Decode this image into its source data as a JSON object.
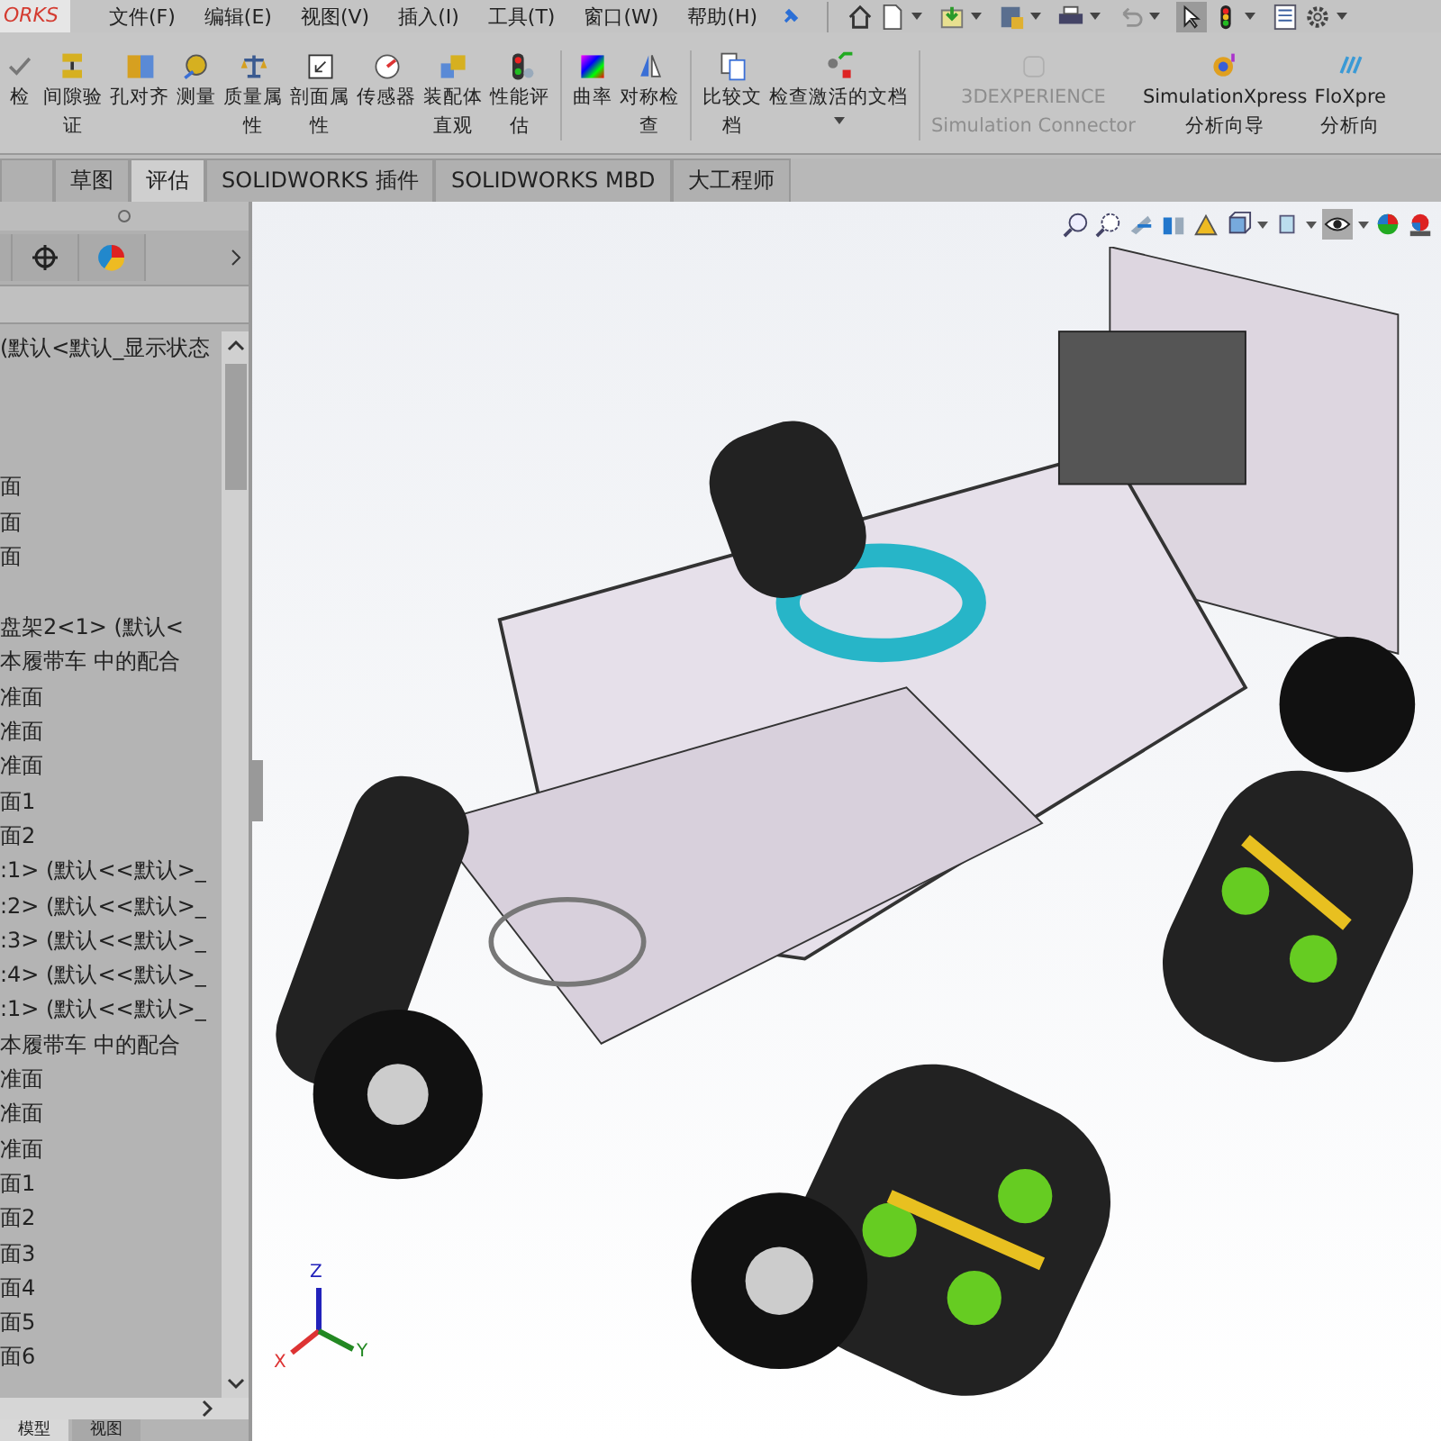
{
  "app_logo": "ORKS",
  "menu": [
    "文件(F)",
    "编辑(E)",
    "视图(V)",
    "插入(I)",
    "工具(T)",
    "窗口(W)",
    "帮助(H)"
  ],
  "quick_access": [
    {
      "kind": "home",
      "disabled": false
    },
    {
      "kind": "new",
      "disabled": false
    },
    {
      "kind": "open",
      "disabled": false
    },
    {
      "kind": "save",
      "disabled": false
    },
    {
      "kind": "print",
      "disabled": false
    },
    {
      "kind": "undo",
      "disabled": true
    },
    {
      "kind": "select",
      "disabled": false
    },
    {
      "kind": "traffic",
      "disabled": false
    },
    {
      "kind": "list",
      "disabled": false
    },
    {
      "kind": "gear",
      "disabled": false
    }
  ],
  "ribbon": [
    [
      {
        "kind": "check",
        "lines": [
          "检"
        ],
        "disabled": false
      },
      {
        "kind": "clearance",
        "lines": [
          "间隙验",
          "证"
        ],
        "disabled": false
      },
      {
        "kind": "hole",
        "lines": [
          "孔对齐"
        ],
        "disabled": false
      },
      {
        "kind": "measure",
        "lines": [
          "测量"
        ],
        "disabled": false
      },
      {
        "kind": "mass",
        "lines": [
          "质量属",
          "性"
        ],
        "disabled": false
      },
      {
        "kind": "section",
        "lines": [
          "剖面属",
          "性"
        ],
        "disabled": false
      },
      {
        "kind": "sensor",
        "lines": [
          "传感器"
        ],
        "disabled": false
      },
      {
        "kind": "assembly",
        "lines": [
          "装配体",
          "直观"
        ],
        "disabled": false
      },
      {
        "kind": "perf",
        "lines": [
          "性能评",
          "估"
        ],
        "disabled": false
      }
    ],
    [
      {
        "kind": "curvature",
        "lines": [
          "曲率"
        ],
        "disabled": false
      },
      {
        "kind": "symmetry",
        "lines": [
          "对称检",
          "查"
        ],
        "disabled": false
      }
    ],
    [
      {
        "kind": "compare",
        "lines": [
          "比较文",
          "档"
        ],
        "disabled": false
      },
      {
        "kind": "checkdoc",
        "lines": [
          "检查激活的文档"
        ],
        "disabled": false
      }
    ],
    [
      {
        "kind": "connector",
        "lines": [
          "3DEXPERIENCE",
          "Simulation Connector"
        ],
        "disabled": true
      },
      {
        "kind": "simxpress",
        "lines": [
          "SimulationXpress",
          "分析向导"
        ],
        "disabled": false
      },
      {
        "kind": "floxpress",
        "lines": [
          "FloXpre",
          "分析向"
        ],
        "disabled": false
      }
    ]
  ],
  "tabs": [
    {
      "label": "草图",
      "selected": false
    },
    {
      "label": "评估",
      "selected": true
    },
    {
      "label": "SOLIDWORKS 插件",
      "selected": false
    },
    {
      "label": "SOLIDWORKS MBD",
      "selected": false
    },
    {
      "label": "大工程师",
      "selected": false
    }
  ],
  "tree": {
    "groups": [
      [
        "(默认<默认_显示状态"
      ],
      [
        "面",
        "面",
        "面"
      ],
      [
        "盘架2<1> (默认<",
        "本履带车 中的配合",
        "准面",
        "准面",
        "准面",
        "面1",
        "面2",
        ":1> (默认<<默认>_",
        ":2> (默认<<默认>_",
        ":3> (默认<<默认>_",
        ":4> (默认<<默认>_",
        ":1> (默认<<默认>_",
        "本履带车 中的配合",
        "准面",
        "准面",
        "准面",
        "面1",
        "面2",
        "面3",
        "面4",
        "面5",
        "面6"
      ]
    ]
  },
  "bottom_tabs": [
    {
      "label": "模型",
      "selected": true
    },
    {
      "label": "视图",
      "selected": false
    }
  ],
  "triad": {
    "x": "X",
    "y": "Y",
    "z": "Z"
  }
}
